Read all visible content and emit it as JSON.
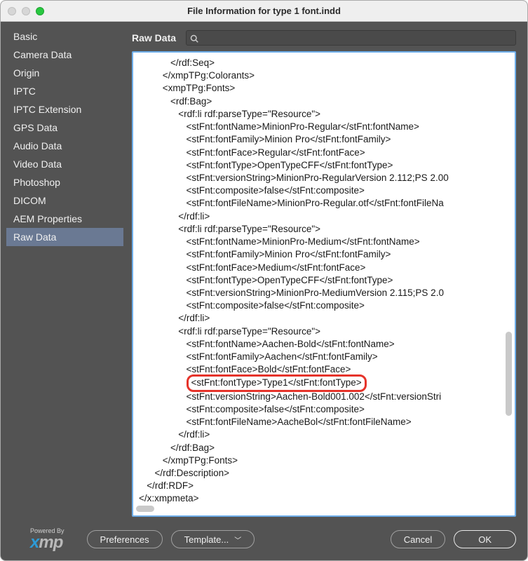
{
  "window": {
    "title": "File Information for type 1 font.indd"
  },
  "sidebar": {
    "items": [
      {
        "label": "Basic"
      },
      {
        "label": "Camera Data"
      },
      {
        "label": "Origin"
      },
      {
        "label": "IPTC"
      },
      {
        "label": "IPTC Extension"
      },
      {
        "label": "GPS Data"
      },
      {
        "label": "Audio Data"
      },
      {
        "label": "Video Data"
      },
      {
        "label": "Photoshop"
      },
      {
        "label": "DICOM"
      },
      {
        "label": "AEM Properties"
      },
      {
        "label": "Raw Data"
      }
    ],
    "selected_index": 11
  },
  "main": {
    "title": "Raw Data",
    "search": {
      "value": "",
      "placeholder": ""
    }
  },
  "raw_lines": [
    "            </rdf:Seq>",
    "         </xmpTPg:Colorants>",
    "         <xmpTPg:Fonts>",
    "            <rdf:Bag>",
    "               <rdf:li rdf:parseType=\"Resource\">",
    "                  <stFnt:fontName>MinionPro-Regular</stFnt:fontName>",
    "                  <stFnt:fontFamily>Minion Pro</stFnt:fontFamily>",
    "                  <stFnt:fontFace>Regular</stFnt:fontFace>",
    "                  <stFnt:fontType>OpenTypeCFF</stFnt:fontType>",
    "                  <stFnt:versionString>MinionPro-RegularVersion 2.112;PS 2.00",
    "                  <stFnt:composite>false</stFnt:composite>",
    "                  <stFnt:fontFileName>MinionPro-Regular.otf</stFnt:fontFileNa",
    "               </rdf:li>",
    "               <rdf:li rdf:parseType=\"Resource\">",
    "                  <stFnt:fontName>MinionPro-Medium</stFnt:fontName>",
    "                  <stFnt:fontFamily>Minion Pro</stFnt:fontFamily>",
    "                  <stFnt:fontFace>Medium</stFnt:fontFace>",
    "                  <stFnt:fontType>OpenTypeCFF</stFnt:fontType>",
    "                  <stFnt:versionString>MinionPro-MediumVersion 2.115;PS 2.0",
    "                  <stFnt:composite>false</stFnt:composite>",
    "               </rdf:li>",
    "               <rdf:li rdf:parseType=\"Resource\">",
    "                  <stFnt:fontName>Aachen-Bold</stFnt:fontName>",
    "                  <stFnt:fontFamily>Aachen</stFnt:fontFamily>",
    "                  <stFnt:fontFace>Bold</stFnt:fontFace>",
    "                  <stFnt:fontType>Type1</stFnt:fontType>",
    "                  <stFnt:versionString>Aachen-Bold001.002</stFnt:versionStri",
    "                  <stFnt:composite>false</stFnt:composite>",
    "                  <stFnt:fontFileName>AacheBol</stFnt:fontFileName>",
    "               </rdf:li>",
    "            </rdf:Bag>",
    "         </xmpTPg:Fonts>",
    "      </rdf:Description>",
    "   </rdf:RDF>",
    "</x:xmpmeta>"
  ],
  "highlight_line_index": 25,
  "footer": {
    "powered_by": "Powered By",
    "logo_x": "x",
    "logo_mp": "mp",
    "preferences": "Preferences",
    "template": "Template...",
    "cancel": "Cancel",
    "ok": "OK"
  }
}
